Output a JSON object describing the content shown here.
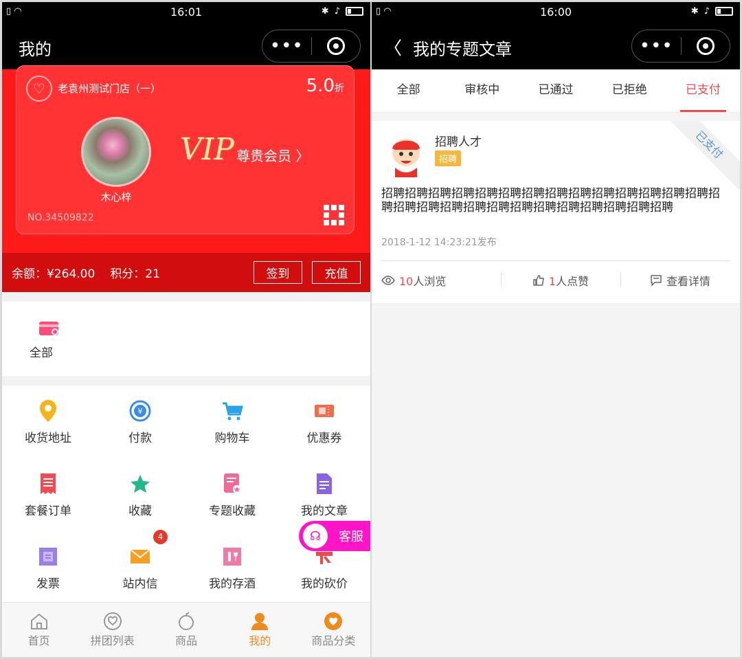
{
  "left": {
    "status": {
      "time": "16:01"
    },
    "nav": {
      "title": "我的",
      "menu": "•••"
    },
    "card": {
      "store_name": "老袁州测试门店（一）",
      "discount_value": "5.0",
      "discount_unit": "折",
      "username": "木心梓",
      "vip": "VIP",
      "vip_sub": "尊贵会员 〉",
      "member_no": "NO.34509822"
    },
    "balance": {
      "label": "余额：¥264.00",
      "points": "积分：21",
      "signin": "签到",
      "recharge": "充值"
    },
    "all": {
      "label": "全部"
    },
    "grid": [
      {
        "label": "收货地址",
        "icon": "location-icon"
      },
      {
        "label": "付款",
        "icon": "payment-icon"
      },
      {
        "label": "购物车",
        "icon": "cart-icon"
      },
      {
        "label": "优惠券",
        "icon": "coupon-icon"
      },
      {
        "label": "套餐订单",
        "icon": "order-icon"
      },
      {
        "label": "收藏",
        "icon": "star-icon"
      },
      {
        "label": "专题收藏",
        "icon": "topic-fav-icon"
      },
      {
        "label": "我的文章",
        "icon": "article-icon"
      },
      {
        "label": "发票",
        "icon": "invoice-icon"
      },
      {
        "label": "站内信",
        "icon": "mail-icon"
      },
      {
        "label": "我的存酒",
        "icon": "wine-icon"
      },
      {
        "label": "我的砍价",
        "icon": "bargain-icon"
      }
    ],
    "mail_badge": "4",
    "kefu": "客服",
    "tabs": [
      {
        "label": "首页",
        "icon": "home-icon"
      },
      {
        "label": "拼团列表",
        "icon": "group-icon"
      },
      {
        "label": "商品",
        "icon": "product-icon"
      },
      {
        "label": "我的",
        "icon": "user-icon"
      },
      {
        "label": "商品分类",
        "icon": "category-icon"
      }
    ],
    "active_tab": 3
  },
  "right": {
    "status": {
      "time": "16:00"
    },
    "nav": {
      "title": "我的专题文章",
      "back": "〈",
      "menu": "•••"
    },
    "segments": [
      "全部",
      "审核中",
      "已通过",
      "已拒绝",
      "已支付"
    ],
    "active_segment": 4,
    "post": {
      "title": "招聘人才",
      "tag": "招聘",
      "ribbon": "已支付",
      "body": "招聘招聘招聘招聘招聘招聘招聘招聘招聘招聘招聘招聘招聘招聘招聘招聘招聘招聘招聘招聘招聘招聘招聘招聘招聘招聘招聘",
      "date": "2018-1-12 14:23:21发布",
      "views_num": "10",
      "views_label": "人浏览",
      "likes_num": "1",
      "likes_label": "人点赞",
      "detail": "查看详情"
    }
  },
  "colors": {
    "red": "#ff1a1a",
    "dark_red": "#d10d0d",
    "accent_orange": "#f08a1a",
    "active_red": "#f04a4a",
    "kefu_pink": "#ff14c8"
  }
}
